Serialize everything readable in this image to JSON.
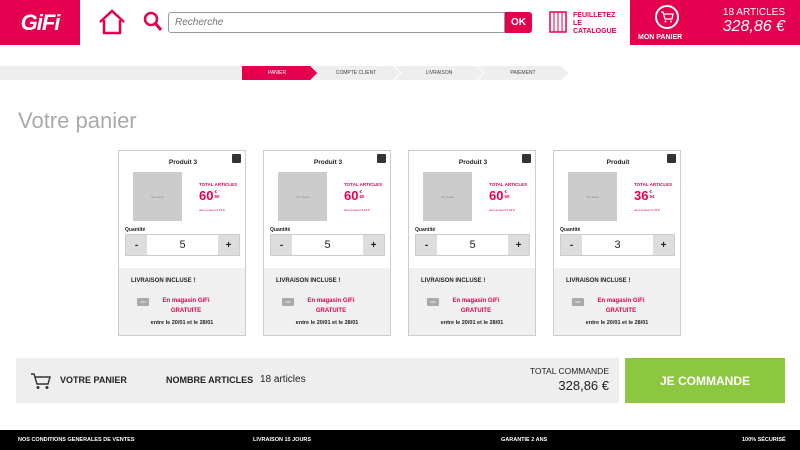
{
  "header": {
    "logo": "GiFi",
    "search_placeholder": "Recherche",
    "search_button": "OK",
    "catalog_line1": "FEUILLETEZ",
    "catalog_line2": "LE",
    "catalog_line3": "CATALOGUE",
    "cart_label": "MON PANIER",
    "cart_articles": "18 ARTICLES",
    "cart_total": "328,86 €"
  },
  "steps": [
    "PANIER",
    "COMPTE CLIENT",
    "LIVRAISON",
    "PAIEMENT"
  ],
  "page_title": "Votre panier",
  "products": [
    {
      "title": "Produit 3",
      "image_text": "No visual",
      "total_label": "TOTAL ARTICLES",
      "price_int": "60",
      "price_cur": "€",
      "price_dec": "50",
      "eco": "dont écopart 0,29 €",
      "qty_label": "Quantité",
      "qty": "5",
      "delivery_title": "LIVRAISON INCLUSE !",
      "mini_logo": "GiFi",
      "store_line1": "En magasin GiFi",
      "store_line2": "GRATUITE",
      "dates": "entre le 20/01  et le 28/01"
    },
    {
      "title": "Produit 3",
      "image_text": "No visual",
      "total_label": "TOTAL ARTICLES",
      "price_int": "60",
      "price_cur": "€",
      "price_dec": "50",
      "eco": "dont écopart 0,29 €",
      "qty_label": "Quantité",
      "qty": "5",
      "delivery_title": "LIVRAISON INCLUSE !",
      "mini_logo": "GiFi",
      "store_line1": "En magasin GiFi",
      "store_line2": "GRATUITE",
      "dates": "entre le 20/01  et le 28/01"
    },
    {
      "title": "Produit 3",
      "image_text": "No visual",
      "total_label": "TOTAL ARTICLES",
      "price_int": "60",
      "price_cur": "€",
      "price_dec": "50",
      "eco": "dont écopart 0,29 €",
      "qty_label": "Quantité",
      "qty": "5",
      "delivery_title": "LIVRAISON INCLUSE !",
      "mini_logo": "GiFi",
      "store_line1": "En magasin GiFi",
      "store_line2": "GRATUITE",
      "dates": "entre le 20/01  et le 28/01"
    },
    {
      "title": "Produit",
      "image_text": "No visual",
      "total_label": "TOTAL ARTICLES",
      "price_int": "36",
      "price_cur": "€",
      "price_dec": "54",
      "eco": "dont écopart 0,29 €",
      "qty_label": "Quantité",
      "qty": "3",
      "delivery_title": "LIVRAISON INCLUSE !",
      "mini_logo": "GiFi",
      "store_line1": "En magasin GiFi",
      "store_line2": "GRATUITE",
      "dates": "entre le 20/01  et le 28/01"
    }
  ],
  "qty_minus": "-",
  "qty_plus": "+",
  "summary": {
    "label": "VOTRE PANIER",
    "nb_label": "NOMBRE ARTICLES",
    "nb_value": "18 articles",
    "total_label": "TOTAL COMMANDE",
    "total_value": "328,86 €"
  },
  "order_button": "JE COMMANDE",
  "footer": [
    "NOS CONDITIONS GENERALES DE VENTES",
    "LIVRAISON 15 JOURS",
    "GARANTIE 2 ANS",
    "100% SÉCURISÉ"
  ],
  "colors": {
    "brand": "#e5004f",
    "order": "#8dc63f"
  }
}
